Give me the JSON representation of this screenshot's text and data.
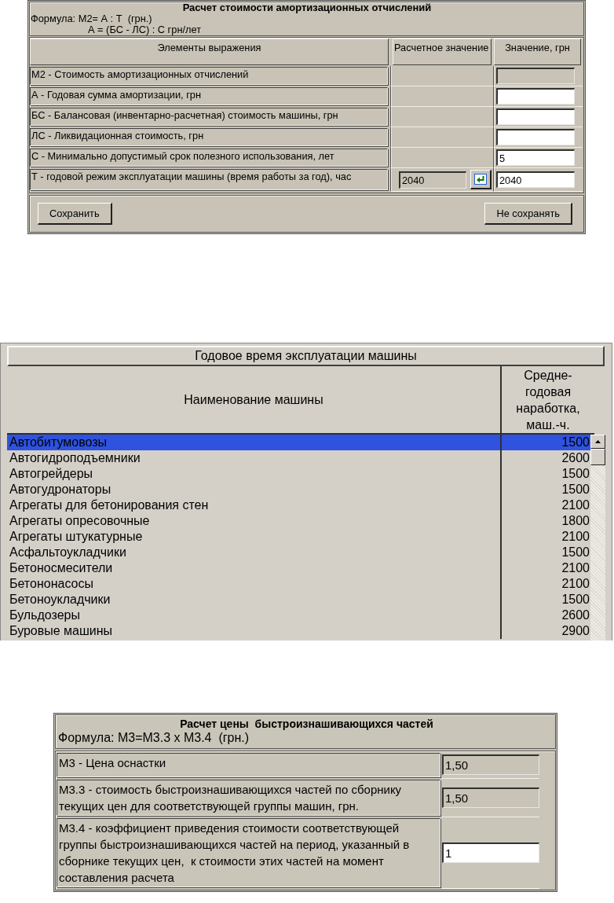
{
  "amortization_form": {
    "title": "Расчет стоимости амортизационных отчислений",
    "formula_lines": [
      "Формула: М2= А : Т  (грн.)",
      "А = (БС - ЛС) : С грн/лет"
    ],
    "columns": [
      "Элементы выражения",
      "Расчетное значение",
      "Значение, грн"
    ],
    "rows": [
      {
        "label": "М2 - Стоимость амортизационных отчислений",
        "field": {
          "disabled": true
        }
      },
      {
        "label": "А - Годовая сумма амортизации, грн",
        "field": {
          "disabled": false
        }
      },
      {
        "label": "БС - Балансовая (инвентарно-расчетная) стоимость машины, грн",
        "field": {
          "disabled": false
        }
      },
      {
        "label": "ЛС - Ликвидационная стоимость, грн",
        "field": {
          "disabled": false
        }
      },
      {
        "label": "С - Минимально допустимый срок полезного использования, лет",
        "field": {
          "value": "5",
          "disabled": false
        }
      },
      {
        "label": "Т - годовой режим эксплуатации машины (время работы за год), час",
        "calculated": {
          "value": "2040",
          "disabled": true
        },
        "field": {
          "value": "2040",
          "disabled": false
        }
      }
    ],
    "buttons": [
      "Сохранить",
      "Не сохранять"
    ]
  },
  "machine_hours_table": {
    "title": "Годовое время эксплуатации машины",
    "columns": [
      "Наименование машины",
      "Средне-годовая наработка, маш.-ч."
    ],
    "rows": [
      {
        "name": "Автобитумовозы",
        "hours": "1500",
        "selected": true
      },
      {
        "name": "Автогидроподъемники",
        "hours": "2600",
        "selected": false
      },
      {
        "name": "Автогрейдеры",
        "hours": "1500",
        "selected": false
      },
      {
        "name": "Автогудронаторы",
        "hours": "1500",
        "selected": false
      },
      {
        "name": "Агрегаты для бетонирования стен",
        "hours": "2100",
        "selected": false
      },
      {
        "name": "Агрегаты опресовочные",
        "hours": "1800",
        "selected": false
      },
      {
        "name": "Агрегаты штукатурные",
        "hours": "2100",
        "selected": false
      },
      {
        "name": "Асфальтоукладчики",
        "hours": "1500",
        "selected": false
      },
      {
        "name": "Бетоносмесители",
        "hours": "2100",
        "selected": false
      },
      {
        "name": "Бетононасосы",
        "hours": "2100",
        "selected": false
      },
      {
        "name": "Бетоноукладчики",
        "hours": "1500",
        "selected": false
      },
      {
        "name": "Бульдозеры",
        "hours": "2600",
        "selected": false
      },
      {
        "name": "Буровые машины",
        "hours": "2900",
        "selected": false
      }
    ]
  },
  "parts_price_form": {
    "title": "Расчет цены  быстроизнашивающихся частей",
    "formula": "Формула: М3=М3.3 х М3.4  (грн.)",
    "rows": [
      {
        "label": "М3 - Цена оснастки",
        "field": {
          "value": "1,50",
          "disabled": true
        }
      },
      {
        "label": "М3.3 - стоимость быстроизнашивающихся частей по сборнику текущих цен для соответствующей группы машин, грн.",
        "field": {
          "value": "1,50",
          "disabled": true
        }
      },
      {
        "label": "М3.4 - коэффициент приведения стоимости соответствующей группы быстроизнашивающихся частей на период, указанный в сборнике текущих цен,  к стоимости этих частей на момент составления расчета",
        "field": {
          "value": "1",
          "disabled": false
        }
      }
    ]
  }
}
